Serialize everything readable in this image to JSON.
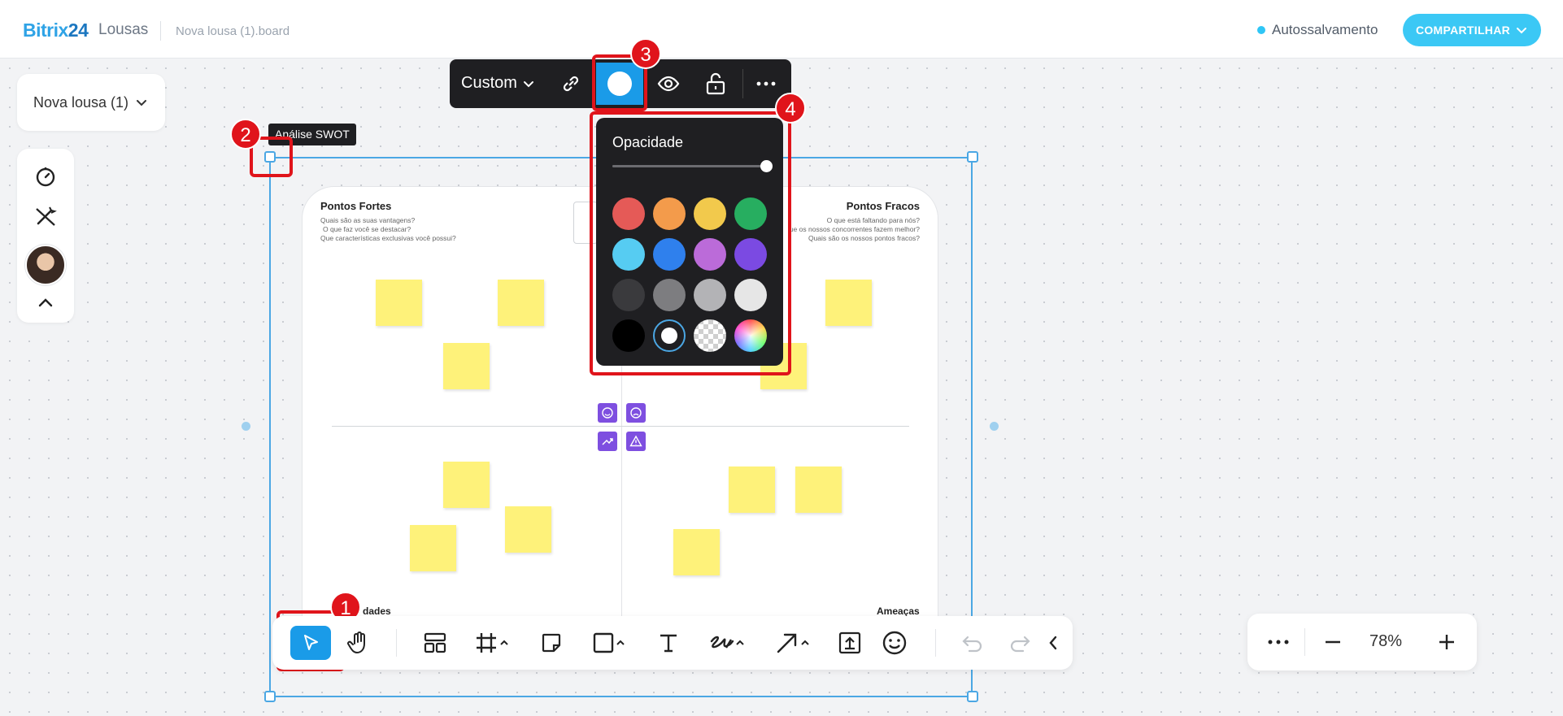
{
  "header": {
    "logo_brand": "Bitrix",
    "logo_num": "24",
    "logo_product": "Lousas",
    "file_name": "Nova lousa (1).board",
    "autosave_label": "Autossalvamento",
    "share_label": "COMPARTILHAR"
  },
  "board_selector": {
    "label": "Nova lousa (1)"
  },
  "selection": {
    "label": "Análise SWOT"
  },
  "board": {
    "q1_title": "Pontos Fortes",
    "q1_lines": [
      "Quais são as suas vantagens?",
      "O que faz você se destacar?",
      "Que características exclusivas você possui?"
    ],
    "q2_title": "Pontos Fracos",
    "q2_lines": [
      "O que está faltando para nós?",
      "ue os nossos concorrentes fazem melhor?",
      "Quais são os nossos pontos fracos?"
    ],
    "q3_title_partial": "dades",
    "q4_title": "Ameaças"
  },
  "context_toolbar": {
    "preset_label": "Custom",
    "icons": [
      "link-icon",
      "color-icon",
      "eye-icon",
      "unlock-icon",
      "more-icon"
    ]
  },
  "color_popup": {
    "title": "Opacidade",
    "opacity": 1.0,
    "colors": [
      "#e55a57",
      "#f39b4b",
      "#f2c94c",
      "#27ae60",
      "#56ccf2",
      "#2f80ed",
      "#bb6bd9",
      "#7b4ae2",
      "#3a3a3d",
      "#7d7d80",
      "#b3b3b6",
      "#e6e6e6",
      "#000000",
      "#ffffff",
      "transparent",
      "custom"
    ],
    "selected": "#ffffff"
  },
  "annotations": [
    "1",
    "2",
    "3",
    "4"
  ],
  "zoom": {
    "value": "78%"
  },
  "colors": {
    "accent": "#1a9be8",
    "share": "#3bc8f5",
    "marker": "#e0141b",
    "sticky": "#fef27a"
  }
}
